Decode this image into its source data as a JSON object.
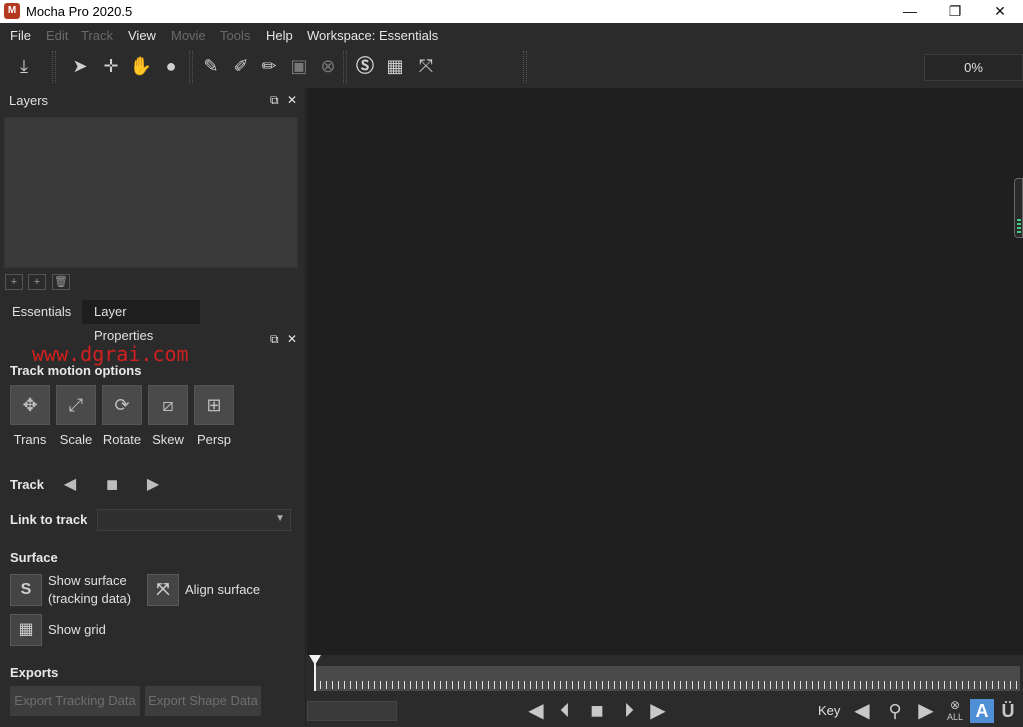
{
  "window": {
    "title": "Mocha Pro 2020.5",
    "app_icon": "M",
    "minimize": "—",
    "maximize": "❐",
    "close": "✕"
  },
  "menu": {
    "file": "File",
    "edit": "Edit",
    "track": "Track",
    "view": "View",
    "movie": "Movie",
    "tools": "Tools",
    "help": "Help",
    "workspace": "Workspace: Essentials"
  },
  "toolbar": {
    "progress_text": "0%",
    "icons": [
      "import-icon",
      "select-icon",
      "add-point-icon",
      "pan-hand-icon",
      "zoom-icon",
      "x-spline-icon",
      "bezier-spline-icon",
      "brush-icon",
      "x-box-icon",
      "x-circle-icon",
      "surface-icon",
      "grid-icon",
      "align-surface-icon"
    ]
  },
  "layers_panel": {
    "title": "Layers",
    "float_glyph": "⧉",
    "close_glyph": "✕"
  },
  "tabs": {
    "essentials": "Essentials",
    "layer_properties": "Layer Properties"
  },
  "essentials": {
    "float_glyph": "⧉",
    "close_glyph": "✕",
    "watermark": "www.dgrai.com",
    "track_motion_title": "Track motion options",
    "motion_labels": {
      "trans": "Trans",
      "scale": "Scale",
      "rotate": "Rotate",
      "skew": "Skew",
      "persp": "Persp"
    },
    "track_label": "Track",
    "link_to_track_label": "Link to track",
    "link_to_track_value": "",
    "surface_title": "Surface",
    "show_surface_line1": "Show surface",
    "show_surface_line2": "(tracking data)",
    "align_surface": "Align surface",
    "show_grid": "Show grid",
    "exports_title": "Exports",
    "export_tracking": "Export Tracking Data",
    "export_shape": "Export Shape Data"
  },
  "bottom": {
    "key_label": "Key",
    "all_label": "ALL",
    "auto_key": "A",
    "u_label": "Ü"
  },
  "colors": {
    "panel_bg": "#2b2b2b",
    "viewer_bg": "#1f1f1f",
    "watermark": "#d21f1f",
    "auto_key_accent": "#4f8fd6"
  }
}
